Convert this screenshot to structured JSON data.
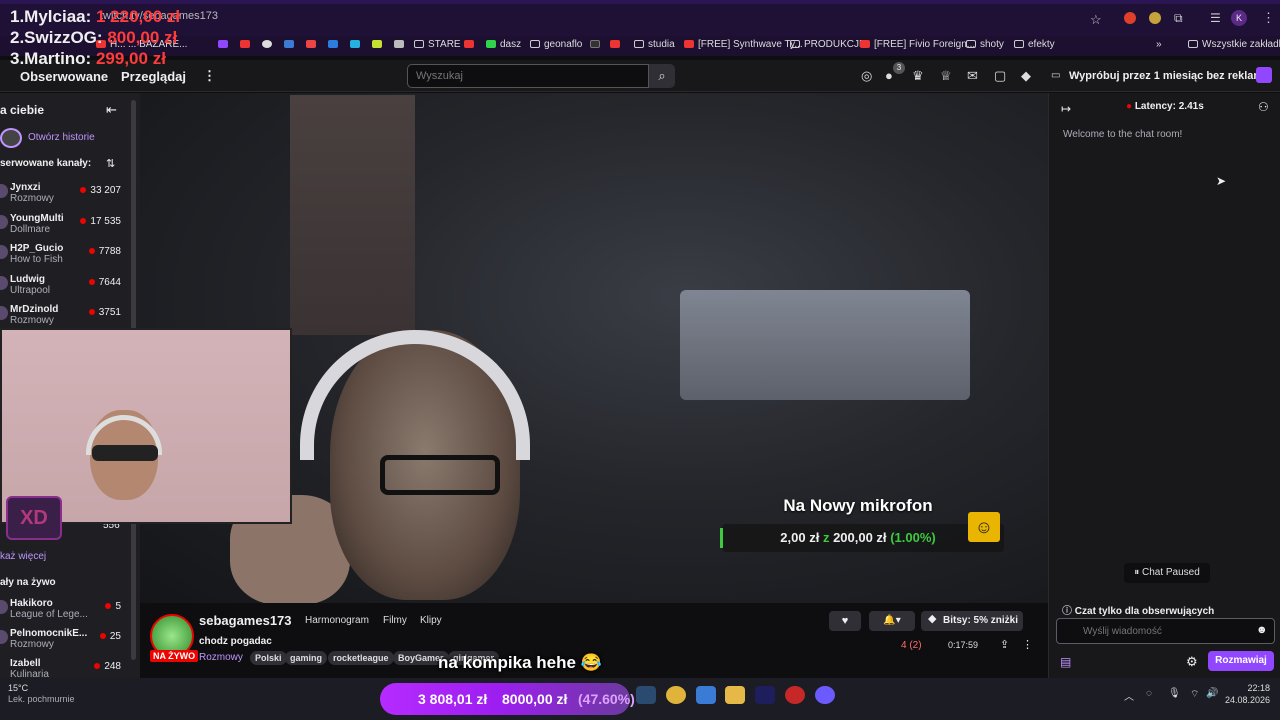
{
  "browser": {
    "url": "twitch.tv/sebagames173",
    "bookmarks": [
      "H...",
      "... BAZARE...",
      "STARE",
      "dasz",
      "geonaflo",
      "studia",
      "[FREE] Synthwave Ty...",
      "PRODUKCJE",
      "[FREE] Fivio Foreign...",
      "shoty",
      "efekty"
    ],
    "all_bookmarks": "Wszystkie zakładki",
    "profile_initial": "K"
  },
  "leaderboard": [
    {
      "name": "1.Mylciaa:",
      "value": "1 220,00 zł"
    },
    {
      "name": "2.SwizzOG:",
      "value": "800,00 zł"
    },
    {
      "name": "3.Martino:",
      "value": "299,00 zł"
    }
  ],
  "nav": {
    "following": "Obserwowane",
    "browse": "Przeglądaj",
    "more": "⋮",
    "search_placeholder": "Wyszukaj",
    "notif_count": "3",
    "prime_label": "Wypróbuj przez 1 miesiąc bez reklam"
  },
  "sidebar": {
    "title": "a ciebie",
    "open_stories": "Otwórz historie",
    "followed_header": "serwowane kanały:",
    "followed": [
      {
        "name": "Jynxzi",
        "game": "Rozmowy",
        "viewers": "33 207"
      },
      {
        "name": "YoungMulti",
        "game": "Dollmare",
        "viewers": "17 535"
      },
      {
        "name": "H2P_Gucio",
        "game": "How to Fish",
        "viewers": "7788"
      },
      {
        "name": "Ludwig",
        "game": "Ultrapool",
        "viewers": "7644"
      },
      {
        "name": "MrDzinold",
        "game": "Rozmowy",
        "viewers": "3751"
      }
    ],
    "hidden_count": "556",
    "show_more": "każ więcej",
    "live_header": "ały na żywo",
    "live": [
      {
        "name": "Hakikoro",
        "game": "League of Lege...",
        "viewers": "5"
      },
      {
        "name": "PelnomocnikE...",
        "game": "Rozmowy",
        "viewers": "25"
      },
      {
        "name": "Izabell",
        "game": "Kulinaria",
        "viewers": "248"
      }
    ]
  },
  "overlay": {
    "xd": "XD",
    "goal_title": "Na Nowy mikrofon",
    "goal_current": "2,00 zł",
    "goal_sep": "z",
    "goal_target": "200,00 zł",
    "goal_percent": "(1.00%)",
    "goal_fraction": 0.01,
    "caption": "na kompika hehe 😂"
  },
  "stream": {
    "channel": "sebagames173",
    "tabs": [
      "Harmonogram",
      "Filmy",
      "Klipy"
    ],
    "title": "chodz pogadac",
    "live_badge": "NA ŻYWO",
    "category": "Rozmowy",
    "tags": [
      "Polski",
      "gaming",
      "rocketleague",
      "BoyGamer",
      "girlgamer"
    ],
    "viewers": "4 (2)",
    "uptime": "0:17:59",
    "bits": "Bitsy: 5% zniżki"
  },
  "chat": {
    "latency": "Latency: 2.41s",
    "welcome": "Welcome to the chat room!",
    "paused": "Chat Paused",
    "followers_only": "Czat tylko dla obserwujących",
    "placeholder": "Wyślij wiadomość",
    "send": "Rozmawiaj"
  },
  "taskbar": {
    "tally_amount": "3 808,01 zł",
    "tally_goal": "8000,00 zł",
    "tally_percent": "(47.60%)",
    "tally_fraction": 0.476,
    "weather_temp": "15°C",
    "weather_desc": "Lek. pochmurnie",
    "time": "22:18",
    "date": "24.08.2026"
  },
  "colors": {
    "twitch_purple": "#9147ff",
    "live_red": "#eb0400",
    "goal_green": "#3ec93e",
    "leader_red": "#ff3b3b"
  }
}
